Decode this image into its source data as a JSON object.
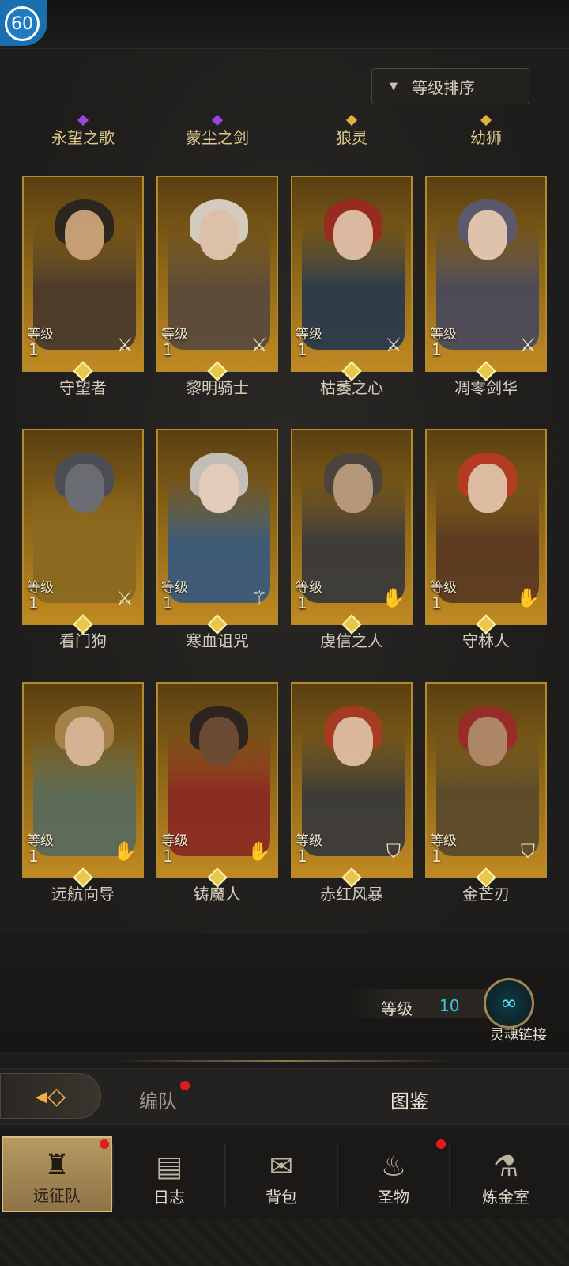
{
  "player": {
    "level": "60"
  },
  "sort": {
    "label": "等级排序"
  },
  "top_names": [
    {
      "text": "永望之歌",
      "gem": "#9b46e0"
    },
    {
      "text": "蒙尘之剑",
      "gem": "#9b46e0"
    },
    {
      "text": "狼灵",
      "gem": "#e0b040"
    },
    {
      "text": "幼狮",
      "gem": "#e0b040"
    }
  ],
  "heroes": [
    {
      "name": "守望者",
      "level_label": "等级",
      "level": "1",
      "class_icon": "sword-icon",
      "skin": "#c9a27a",
      "hair": "#2a2420",
      "cloth": "#4a3a2a"
    },
    {
      "name": "黎明骑士",
      "level_label": "等级",
      "level": "1",
      "class_icon": "sword-icon",
      "skin": "#e2c6b0",
      "hair": "#d8d2c8",
      "cloth": "#5a4a3a"
    },
    {
      "name": "枯萎之心",
      "level_label": "等级",
      "level": "1",
      "class_icon": "sword-icon",
      "skin": "#e0bfa8",
      "hair": "#9a2a20",
      "cloth": "#2a3a4a"
    },
    {
      "name": "凋零剑华",
      "level_label": "等级",
      "level": "1",
      "class_icon": "sword-icon",
      "skin": "#e4c8b4",
      "hair": "#5a5a70",
      "cloth": "#4a4a5a"
    },
    {
      "name": "看门狗",
      "level_label": "等级",
      "level": "1",
      "class_icon": "sword-icon",
      "skin": "#6a6e78",
      "hair": "#4a4e58",
      "cloth": "#8a6a20"
    },
    {
      "name": "寒血诅咒",
      "level_label": "等级",
      "level": "1",
      "class_icon": "staff-icon",
      "skin": "#e8d2c4",
      "hair": "#c8c4c0",
      "cloth": "#3a5a7a"
    },
    {
      "name": "虔信之人",
      "level_label": "等级",
      "level": "1",
      "class_icon": "hand-icon",
      "skin": "#b89a80",
      "hair": "#4a4440",
      "cloth": "#3a3a3a"
    },
    {
      "name": "守林人",
      "level_label": "等级",
      "level": "1",
      "class_icon": "hand-icon",
      "skin": "#e2c2a8",
      "hair": "#b83a24",
      "cloth": "#5a3a22"
    },
    {
      "name": "远航向导",
      "level_label": "等级",
      "level": "1",
      "class_icon": "hand-icon",
      "skin": "#d8b898",
      "hair": "#a8844a",
      "cloth": "#5a6a5a"
    },
    {
      "name": "铸魔人",
      "level_label": "等级",
      "level": "1",
      "class_icon": "hand-icon",
      "skin": "#6a4a34",
      "hair": "#2a2220",
      "cloth": "#8a2a22"
    },
    {
      "name": "赤红风暴",
      "level_label": "等级",
      "level": "1",
      "class_icon": "shield-icon",
      "skin": "#e0bca4",
      "hair": "#a83a22",
      "cloth": "#3a3a3a"
    },
    {
      "name": "金芒刃",
      "level_label": "等级",
      "level": "1",
      "class_icon": "shield-icon",
      "skin": "#b08a6a",
      "hair": "#9a2a2a",
      "cloth": "#5a4a2a"
    }
  ],
  "soul": {
    "level_label": "等级",
    "level_value": "10",
    "link_label": "灵魂链接"
  },
  "tabs": {
    "team": "编队",
    "codex": "图鉴"
  },
  "nav": [
    {
      "label": "远征队",
      "icon": "helmet-icon",
      "active": true
    },
    {
      "label": "日志",
      "icon": "scroll-icon",
      "active": false
    },
    {
      "label": "背包",
      "icon": "backpack-icon",
      "active": false
    },
    {
      "label": "圣物",
      "icon": "torch-icon",
      "active": false
    },
    {
      "label": "炼金室",
      "icon": "alchemy-icon",
      "active": false
    }
  ]
}
